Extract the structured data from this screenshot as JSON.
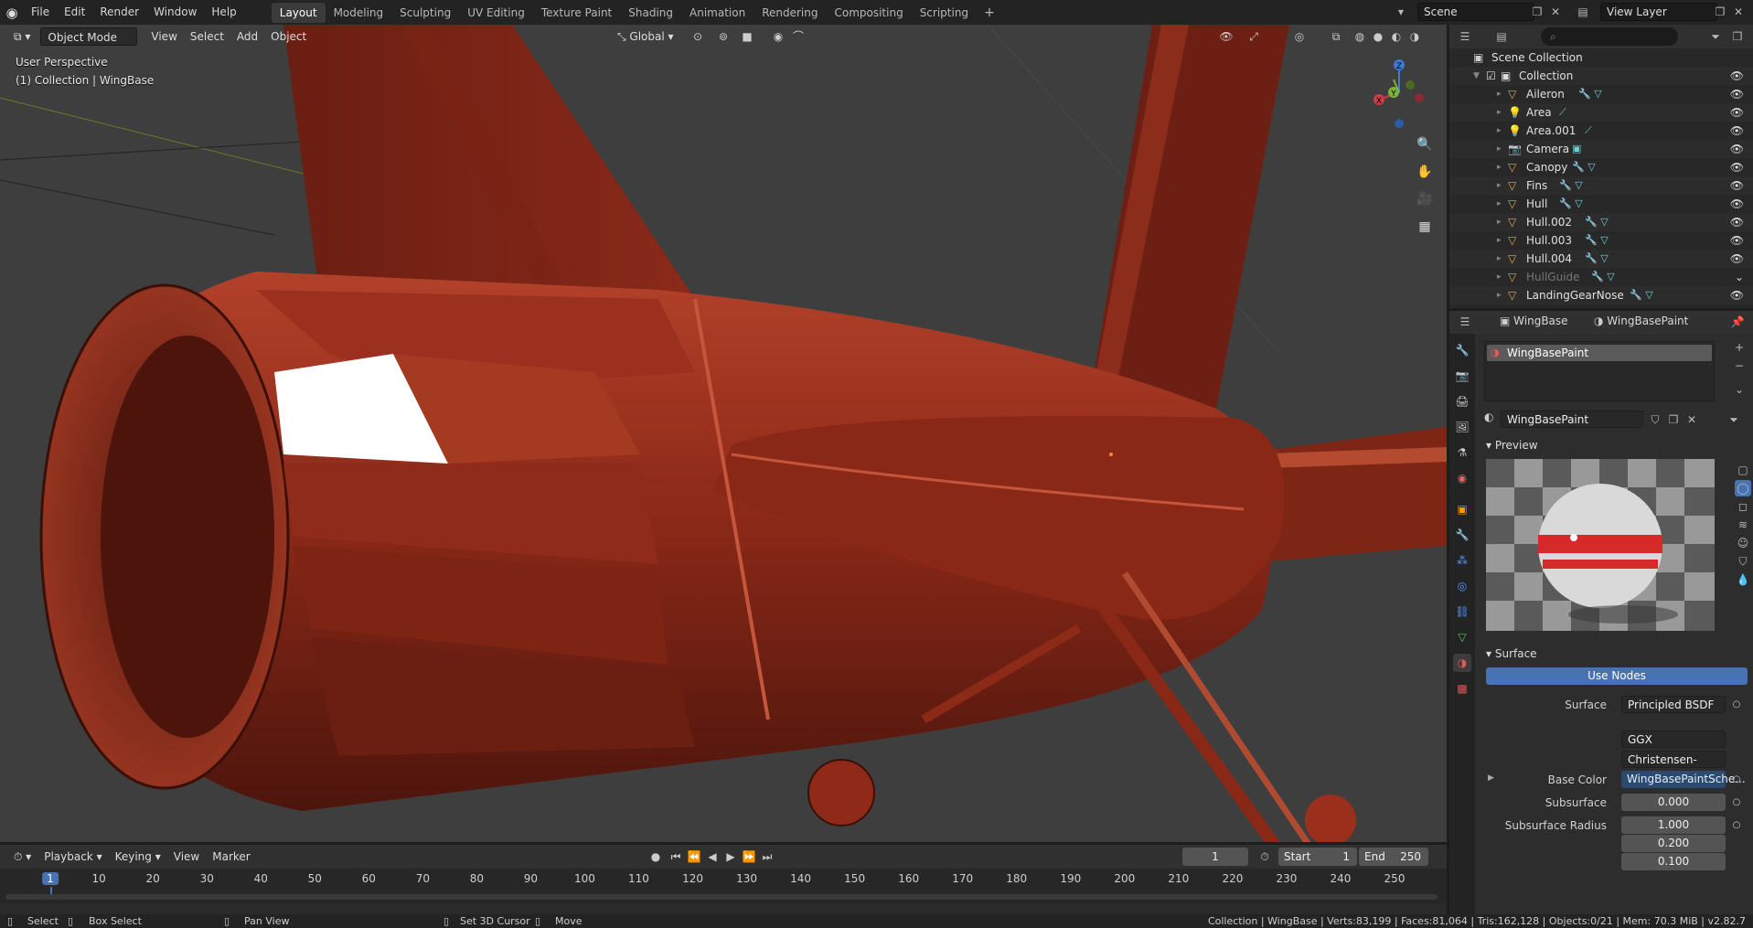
{
  "topbar": {
    "menus": [
      "File",
      "Edit",
      "Render",
      "Window",
      "Help"
    ],
    "workspaces": [
      "Layout",
      "Modeling",
      "Sculpting",
      "UV Editing",
      "Texture Paint",
      "Shading",
      "Animation",
      "Rendering",
      "Compositing",
      "Scripting"
    ],
    "active_workspace": "Layout",
    "add_tab": "+",
    "scene_name": "Scene",
    "view_layer": "View Layer"
  },
  "viewport": {
    "mode": "Object Mode",
    "menus": [
      "View",
      "Select",
      "Add",
      "Object"
    ],
    "transform_orientation": "Global",
    "overlay_line1": "User Perspective",
    "overlay_line2": "(1) Collection | WingBase",
    "axes": {
      "x": "X",
      "y": "Y",
      "z": "Z"
    }
  },
  "outliner": {
    "search_placeholder": "",
    "scene_collection": "Scene Collection",
    "collection": "Collection",
    "items": [
      {
        "name": "Aileron",
        "type": "mesh",
        "dimmed": false
      },
      {
        "name": "Area",
        "type": "light",
        "dimmed": false
      },
      {
        "name": "Area.001",
        "type": "light",
        "dimmed": false
      },
      {
        "name": "Camera",
        "type": "camera",
        "dimmed": false
      },
      {
        "name": "Canopy",
        "type": "mesh",
        "dimmed": false
      },
      {
        "name": "Fins",
        "type": "mesh",
        "dimmed": false
      },
      {
        "name": "Hull",
        "type": "mesh",
        "dimmed": false
      },
      {
        "name": "Hull.002",
        "type": "mesh",
        "dimmed": false
      },
      {
        "name": "Hull.003",
        "type": "mesh",
        "dimmed": false
      },
      {
        "name": "Hull.004",
        "type": "mesh",
        "dimmed": false
      },
      {
        "name": "HullGuide",
        "type": "mesh",
        "dimmed": true
      },
      {
        "name": "LandingGearNose",
        "type": "mesh",
        "dimmed": false
      }
    ]
  },
  "properties": {
    "object_name": "WingBase",
    "material_name": "WingBasePaint",
    "slot_name": "WingBasePaint",
    "datablock_name": "WingBasePaint",
    "preview_label": "Preview",
    "surface_label": "Surface",
    "use_nodes": "Use Nodes",
    "fields": {
      "surface_label": "Surface",
      "surface_value": "Principled BSDF",
      "distribution": "GGX",
      "subsurface_method": "Christensen-Burley",
      "base_color_label": "Base Color",
      "base_color_value": "WingBasePaintSche...",
      "subsurface_label": "Subsurface",
      "subsurface_value": "0.000",
      "subsurface_radius_label": "Subsurface Radius",
      "radius_r": "1.000",
      "radius_g": "0.200",
      "radius_b": "0.100"
    }
  },
  "timeline": {
    "menus": [
      "Playback",
      "Keying",
      "View",
      "Marker"
    ],
    "current_frame": "1",
    "start_label": "Start",
    "start": "1",
    "end_label": "End",
    "end": "250",
    "ticks": [
      "1",
      "10",
      "20",
      "30",
      "40",
      "50",
      "60",
      "70",
      "80",
      "90",
      "100",
      "110",
      "120",
      "130",
      "140",
      "150",
      "160",
      "170",
      "180",
      "190",
      "200",
      "210",
      "220",
      "230",
      "240",
      "250"
    ]
  },
  "statusbar": {
    "select": "Select",
    "box_select": "Box Select",
    "pan_view": "Pan View",
    "set_cursor": "Set 3D Cursor",
    "move": "Move",
    "stats": "Collection | WingBase | Verts:83,199 | Faces:81,064 | Tris:162,128 | Objects:0/21 | Mem: 70.3 MiB | v2.82.7"
  },
  "colors": {
    "accent": "#4772b3",
    "paint": "#9b2a1a",
    "highlight": "#ffffff"
  }
}
